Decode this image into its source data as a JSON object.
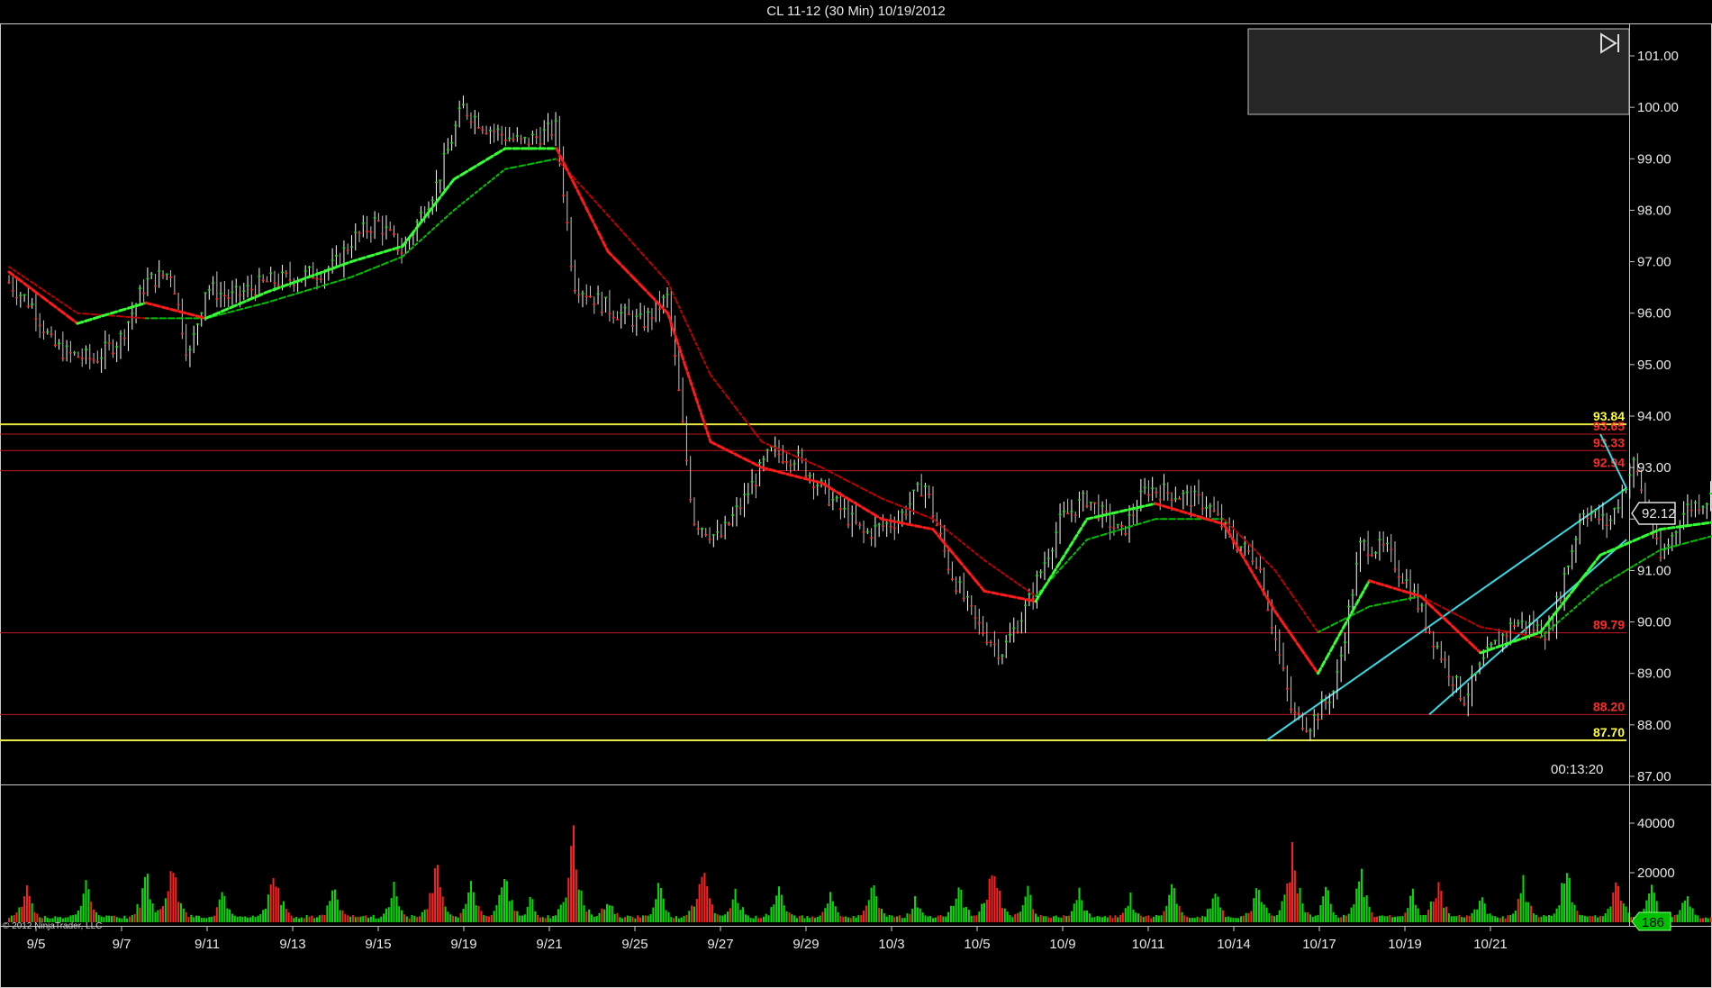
{
  "window": {
    "title": "CL 11-12 (30 Min)  10/19/2012"
  },
  "timer": "00:13:20",
  "copyright": "© 2012 NinjaTrader, LLC",
  "current_price_label": "92.12",
  "current_volume_label": "186",
  "colors": {
    "background": "#000000",
    "up_bar": "#00e000",
    "down_bar": "#ff2020",
    "ma_fast_down": "#ff1a1a",
    "ma_slow_down": "#c00000",
    "ma_fast_up": "#33ff33",
    "ma_slow_up": "#00c000",
    "trendline": "#39d9e6",
    "support_major": "#e8e840",
    "support_minor": "#c21616",
    "label_red": "#ff2a2a",
    "label_yellow": "#ffff33",
    "panel_border": "#c8c8c8"
  },
  "chart_data": {
    "type": "candlestick",
    "instrument": "CL 11-12",
    "interval": "30 Min",
    "ylim": [
      87.0,
      101.2
    ],
    "y_ticks": [
      "101.00",
      "100.00",
      "99.00",
      "98.00",
      "97.00",
      "96.00",
      "95.00",
      "94.00",
      "93.00",
      "92.00",
      "91.00",
      "90.00",
      "89.00",
      "88.00",
      "87.00"
    ],
    "x_ticks": [
      "9/5",
      "9/7",
      "9/11",
      "9/13",
      "9/15",
      "9/19",
      "9/21",
      "9/25",
      "9/27",
      "9/29",
      "10/3",
      "10/5",
      "10/9",
      "10/11",
      "10/14",
      "10/17",
      "10/19",
      "10/21"
    ],
    "price_path": [
      {
        "x": 0.0,
        "y": 96.6
      },
      {
        "x": 0.3,
        "y": 96.1
      },
      {
        "x": 0.5,
        "y": 95.4
      },
      {
        "x": 0.7,
        "y": 95.2
      },
      {
        "x": 1.0,
        "y": 95.1
      },
      {
        "x": 1.3,
        "y": 95.5
      },
      {
        "x": 1.6,
        "y": 96.6
      },
      {
        "x": 1.9,
        "y": 96.8
      },
      {
        "x": 2.1,
        "y": 95.1
      },
      {
        "x": 2.3,
        "y": 96.5
      },
      {
        "x": 2.6,
        "y": 96.3
      },
      {
        "x": 3.0,
        "y": 96.6
      },
      {
        "x": 3.4,
        "y": 96.7
      },
      {
        "x": 3.8,
        "y": 96.9
      },
      {
        "x": 4.0,
        "y": 97.4
      },
      {
        "x": 4.3,
        "y": 97.8
      },
      {
        "x": 4.6,
        "y": 97.2
      },
      {
        "x": 5.0,
        "y": 98.5
      },
      {
        "x": 5.3,
        "y": 100.0
      },
      {
        "x": 5.6,
        "y": 99.6
      },
      {
        "x": 6.0,
        "y": 99.3
      },
      {
        "x": 6.4,
        "y": 99.6
      },
      {
        "x": 6.6,
        "y": 96.6
      },
      {
        "x": 7.0,
        "y": 96.1
      },
      {
        "x": 7.4,
        "y": 95.8
      },
      {
        "x": 7.7,
        "y": 96.3
      },
      {
        "x": 8.0,
        "y": 92.0
      },
      {
        "x": 8.3,
        "y": 91.6
      },
      {
        "x": 8.6,
        "y": 92.4
      },
      {
        "x": 8.9,
        "y": 93.3
      },
      {
        "x": 9.2,
        "y": 93.2
      },
      {
        "x": 9.6,
        "y": 92.4
      },
      {
        "x": 10.0,
        "y": 91.7
      },
      {
        "x": 10.4,
        "y": 92.0
      },
      {
        "x": 10.7,
        "y": 92.7
      },
      {
        "x": 11.0,
        "y": 91.0
      },
      {
        "x": 11.3,
        "y": 90.0
      },
      {
        "x": 11.6,
        "y": 89.4
      },
      {
        "x": 11.9,
        "y": 90.3
      },
      {
        "x": 12.3,
        "y": 92.0
      },
      {
        "x": 12.6,
        "y": 92.4
      },
      {
        "x": 13.0,
        "y": 91.7
      },
      {
        "x": 13.3,
        "y": 92.6
      },
      {
        "x": 13.6,
        "y": 92.5
      },
      {
        "x": 14.0,
        "y": 92.3
      },
      {
        "x": 14.3,
        "y": 91.6
      },
      {
        "x": 14.6,
        "y": 91.2
      },
      {
        "x": 15.0,
        "y": 88.2
      },
      {
        "x": 15.2,
        "y": 88.0
      },
      {
        "x": 15.5,
        "y": 88.7
      },
      {
        "x": 15.8,
        "y": 91.5
      },
      {
        "x": 16.1,
        "y": 91.4
      },
      {
        "x": 16.4,
        "y": 90.6
      },
      {
        "x": 16.7,
        "y": 89.5
      },
      {
        "x": 17.0,
        "y": 88.5
      },
      {
        "x": 17.3,
        "y": 89.4
      },
      {
        "x": 17.6,
        "y": 90.0
      },
      {
        "x": 18.0,
        "y": 89.8
      },
      {
        "x": 18.4,
        "y": 92.2
      },
      {
        "x": 18.7,
        "y": 91.9
      },
      {
        "x": 19.0,
        "y": 93.1
      },
      {
        "x": 19.3,
        "y": 91.2
      },
      {
        "x": 19.6,
        "y": 92.2
      },
      {
        "x": 20.0,
        "y": 92.5
      },
      {
        "x": 20.4,
        "y": 91.8
      },
      {
        "x": 20.8,
        "y": 91.4
      },
      {
        "x": 21.0,
        "y": 90.2
      },
      {
        "x": 21.3,
        "y": 91.5
      },
      {
        "x": 21.7,
        "y": 91.7
      },
      {
        "x": 22.0,
        "y": 92.0
      },
      {
        "x": 22.4,
        "y": 92.2
      },
      {
        "x": 22.8,
        "y": 92.0
      },
      {
        "x": 23.0,
        "y": 91.1
      },
      {
        "x": 23.3,
        "y": 92.0
      },
      {
        "x": 23.6,
        "y": 92.1
      },
      {
        "x": 23.8,
        "y": 92.05
      }
    ],
    "ma_fast": [
      {
        "x": 0.0,
        "y": 96.8
      },
      {
        "x": 0.8,
        "y": 95.8
      },
      {
        "x": 1.6,
        "y": 96.2
      },
      {
        "x": 2.3,
        "y": 95.9
      },
      {
        "x": 3.0,
        "y": 96.4
      },
      {
        "x": 4.0,
        "y": 97.0
      },
      {
        "x": 4.6,
        "y": 97.3
      },
      {
        "x": 5.2,
        "y": 98.6
      },
      {
        "x": 5.8,
        "y": 99.2
      },
      {
        "x": 6.4,
        "y": 99.2
      },
      {
        "x": 7.0,
        "y": 97.2
      },
      {
        "x": 7.7,
        "y": 96.0
      },
      {
        "x": 8.2,
        "y": 93.5
      },
      {
        "x": 8.8,
        "y": 93.0
      },
      {
        "x": 9.5,
        "y": 92.7
      },
      {
        "x": 10.2,
        "y": 92.0
      },
      {
        "x": 10.8,
        "y": 91.8
      },
      {
        "x": 11.4,
        "y": 90.6
      },
      {
        "x": 12.0,
        "y": 90.4
      },
      {
        "x": 12.6,
        "y": 92.0
      },
      {
        "x": 13.4,
        "y": 92.3
      },
      {
        "x": 14.2,
        "y": 91.9
      },
      {
        "x": 14.8,
        "y": 90.2
      },
      {
        "x": 15.3,
        "y": 89.0
      },
      {
        "x": 15.9,
        "y": 90.8
      },
      {
        "x": 16.5,
        "y": 90.5
      },
      {
        "x": 17.2,
        "y": 89.4
      },
      {
        "x": 17.9,
        "y": 89.8
      },
      {
        "x": 18.6,
        "y": 91.3
      },
      {
        "x": 19.3,
        "y": 91.8
      },
      {
        "x": 20.2,
        "y": 92.0
      },
      {
        "x": 21.0,
        "y": 91.4
      },
      {
        "x": 21.8,
        "y": 91.7
      },
      {
        "x": 22.6,
        "y": 92.0
      },
      {
        "x": 23.2,
        "y": 91.8
      },
      {
        "x": 23.8,
        "y": 92.0
      }
    ],
    "ma_slow": [
      {
        "x": 0.0,
        "y": 96.9
      },
      {
        "x": 0.8,
        "y": 96.0
      },
      {
        "x": 1.6,
        "y": 95.9
      },
      {
        "x": 2.3,
        "y": 95.9
      },
      {
        "x": 3.0,
        "y": 96.2
      },
      {
        "x": 4.0,
        "y": 96.7
      },
      {
        "x": 4.6,
        "y": 97.1
      },
      {
        "x": 5.2,
        "y": 98.0
      },
      {
        "x": 5.8,
        "y": 98.8
      },
      {
        "x": 6.4,
        "y": 99.0
      },
      {
        "x": 7.0,
        "y": 97.9
      },
      {
        "x": 7.7,
        "y": 96.6
      },
      {
        "x": 8.2,
        "y": 94.8
      },
      {
        "x": 8.8,
        "y": 93.5
      },
      {
        "x": 9.5,
        "y": 93.0
      },
      {
        "x": 10.2,
        "y": 92.4
      },
      {
        "x": 10.8,
        "y": 92.0
      },
      {
        "x": 11.4,
        "y": 91.2
      },
      {
        "x": 12.0,
        "y": 90.5
      },
      {
        "x": 12.6,
        "y": 91.6
      },
      {
        "x": 13.4,
        "y": 92.0
      },
      {
        "x": 14.2,
        "y": 92.0
      },
      {
        "x": 14.8,
        "y": 91.0
      },
      {
        "x": 15.3,
        "y": 89.8
      },
      {
        "x": 15.9,
        "y": 90.3
      },
      {
        "x": 16.5,
        "y": 90.5
      },
      {
        "x": 17.2,
        "y": 89.9
      },
      {
        "x": 17.9,
        "y": 89.7
      },
      {
        "x": 18.6,
        "y": 90.7
      },
      {
        "x": 19.3,
        "y": 91.4
      },
      {
        "x": 20.2,
        "y": 91.8
      },
      {
        "x": 21.0,
        "y": 91.6
      },
      {
        "x": 21.8,
        "y": 91.6
      },
      {
        "x": 22.6,
        "y": 91.9
      },
      {
        "x": 23.2,
        "y": 91.9
      },
      {
        "x": 23.8,
        "y": 92.0
      }
    ],
    "horizontal_levels": [
      {
        "value": 93.84,
        "label": "93.84",
        "style": "major"
      },
      {
        "value": 93.65,
        "label": "93.65",
        "style": "minor"
      },
      {
        "value": 93.33,
        "label": "93.33",
        "style": "minor"
      },
      {
        "value": 92.94,
        "label": "92.94",
        "style": "minor"
      },
      {
        "value": 89.79,
        "label": "89.79",
        "style": "minor"
      },
      {
        "value": 88.2,
        "label": "88.20",
        "style": "minor"
      },
      {
        "value": 87.7,
        "label": "87.70",
        "style": "major"
      }
    ],
    "trendlines": [
      {
        "x1": 19.1,
        "y1": 93.65,
        "x2": 24.6,
        "y2": 92.6
      },
      {
        "x1": 15.2,
        "y1": 87.7,
        "x2": 24.6,
        "y2": 92.6
      },
      {
        "x1": 17.1,
        "y1": 88.2,
        "x2": 24.6,
        "y2": 91.6
      }
    ],
    "volume": {
      "ylim": [
        0,
        45000
      ],
      "y_ticks": [
        "40000",
        "20000"
      ],
      "spikes": [
        {
          "x": 0.2,
          "v": 18000,
          "dir": "down"
        },
        {
          "x": 0.9,
          "v": 22000,
          "dir": "up"
        },
        {
          "x": 1.6,
          "v": 25000,
          "dir": "up"
        },
        {
          "x": 1.9,
          "v": 35000,
          "dir": "down"
        },
        {
          "x": 2.5,
          "v": 15000,
          "dir": "up"
        },
        {
          "x": 3.1,
          "v": 32000,
          "dir": "down"
        },
        {
          "x": 3.8,
          "v": 18000,
          "dir": "up"
        },
        {
          "x": 4.5,
          "v": 17000,
          "dir": "up"
        },
        {
          "x": 5.0,
          "v": 33000,
          "dir": "down"
        },
        {
          "x": 5.4,
          "v": 20000,
          "dir": "up"
        },
        {
          "x": 5.8,
          "v": 26000,
          "dir": "up"
        },
        {
          "x": 6.1,
          "v": 12000,
          "dir": "up"
        },
        {
          "x": 6.6,
          "v": 47000,
          "dir": "down"
        },
        {
          "x": 7.0,
          "v": 14000,
          "dir": "up"
        },
        {
          "x": 7.6,
          "v": 18000,
          "dir": "up"
        },
        {
          "x": 8.1,
          "v": 32000,
          "dir": "down"
        },
        {
          "x": 8.5,
          "v": 16000,
          "dir": "up"
        },
        {
          "x": 9.0,
          "v": 21000,
          "dir": "up"
        },
        {
          "x": 9.6,
          "v": 14000,
          "dir": "up"
        },
        {
          "x": 10.1,
          "v": 19000,
          "dir": "up"
        },
        {
          "x": 10.6,
          "v": 13000,
          "dir": "up"
        },
        {
          "x": 11.1,
          "v": 22000,
          "dir": "up"
        },
        {
          "x": 11.5,
          "v": 37000,
          "dir": "down"
        },
        {
          "x": 11.9,
          "v": 18000,
          "dir": "up"
        },
        {
          "x": 12.5,
          "v": 17000,
          "dir": "up"
        },
        {
          "x": 13.1,
          "v": 15000,
          "dir": "up"
        },
        {
          "x": 13.6,
          "v": 19000,
          "dir": "up"
        },
        {
          "x": 14.1,
          "v": 16000,
          "dir": "up"
        },
        {
          "x": 14.6,
          "v": 20000,
          "dir": "up"
        },
        {
          "x": 15.0,
          "v": 42000,
          "dir": "down"
        },
        {
          "x": 15.4,
          "v": 17000,
          "dir": "up"
        },
        {
          "x": 15.8,
          "v": 26000,
          "dir": "up"
        },
        {
          "x": 16.4,
          "v": 16000,
          "dir": "up"
        },
        {
          "x": 16.7,
          "v": 22000,
          "dir": "down"
        },
        {
          "x": 17.2,
          "v": 14000,
          "dir": "up"
        },
        {
          "x": 17.7,
          "v": 20000,
          "dir": "up"
        },
        {
          "x": 18.2,
          "v": 29000,
          "dir": "up"
        },
        {
          "x": 18.8,
          "v": 22000,
          "dir": "down"
        },
        {
          "x": 19.2,
          "v": 19000,
          "dir": "up"
        },
        {
          "x": 19.6,
          "v": 16000,
          "dir": "up"
        },
        {
          "x": 20.1,
          "v": 14000,
          "dir": "up"
        },
        {
          "x": 20.6,
          "v": 17000,
          "dir": "up"
        },
        {
          "x": 21.1,
          "v": 19000,
          "dir": "down"
        },
        {
          "x": 21.5,
          "v": 14000,
          "dir": "up"
        },
        {
          "x": 22.0,
          "v": 15000,
          "dir": "up"
        },
        {
          "x": 22.3,
          "v": 26000,
          "dir": "down"
        },
        {
          "x": 22.8,
          "v": 14000,
          "dir": "down"
        },
        {
          "x": 23.2,
          "v": 10000,
          "dir": "up"
        }
      ]
    }
  }
}
